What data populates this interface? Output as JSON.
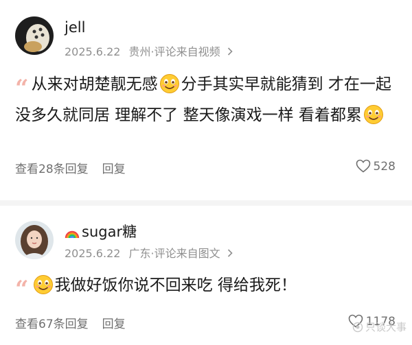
{
  "comments": [
    {
      "username": "jell",
      "date": "2025.6.22",
      "location": "贵州",
      "source": "评论来自视频",
      "text_segments": [
        "从来对胡楚靓无感",
        "分手其实早就能猜到 才在一起没多久就同居 理解不了 整天像演戏一样 看着都累"
      ],
      "replies_link": "查看28条回复",
      "reply_label": "回复",
      "likes": "528"
    },
    {
      "username": "sugar糖",
      "date": "2025.6.22",
      "location": "广东",
      "source": "评论来自图文",
      "text_segments": [
        "",
        "我做好饭你说不回来吃 得给我死！"
      ],
      "replies_link": "查看67条回复",
      "reply_label": "回复",
      "likes": "1178"
    }
  ],
  "meta_separator": "·",
  "quote_mark": "“",
  "watermark": "只谈大事",
  "colors": {
    "text": "#1a1a1a",
    "meta": "#8f8f8f",
    "quote": "#f3b3a9",
    "divider": "#f4f4f4",
    "emoji": "#ffcc33"
  }
}
